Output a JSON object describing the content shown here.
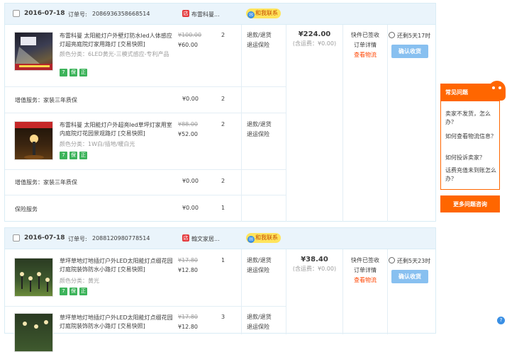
{
  "orders": [
    {
      "date": "2016-07-18",
      "order_label": "订单号:",
      "order_no": "2086936358668514",
      "shop": "布雷科曼...",
      "chat": "和我联系",
      "total": "¥224.00",
      "shipping": "(含运费：¥0.00)",
      "status": "快件已签收",
      "detail": "订单详情",
      "logistics": "查看物流",
      "timer": "还剩5天17时",
      "confirm": "确认收货",
      "items": [
        {
          "title": "布雷科曼 太阳能灯户外壁灯防水led人体感应灯超亮庭院灯家用路灯 [交易快照]",
          "sku": "颜色分类：6LED黄光-三模式感应-专利产品",
          "old_price": "¥100.00",
          "price": "¥60.00",
          "qty": "2",
          "svc1": "退款/退货",
          "svc2": "退运保险"
        },
        {
          "title": "布雷科曼 太阳能灯户外超亮led草坪灯家用室内庭院灯花园景观路灯 [交易快照]",
          "sku": "颜色分类：1W白/插地/暖白光",
          "old_price": "¥88.00",
          "price": "¥52.00",
          "qty": "2",
          "svc1": "退款/退货",
          "svc2": "退运保险"
        }
      ],
      "service_rows": [
        {
          "label": "增值服务：家装三年质保",
          "price": "¥0.00",
          "qty": "2"
        },
        {
          "label": "增值服务：家装三年质保",
          "price": "¥0.00",
          "qty": "2"
        },
        {
          "label": "保险服务",
          "price": "¥0.00",
          "qty": "1"
        }
      ]
    },
    {
      "date": "2016-07-18",
      "order_label": "订单号:",
      "order_no": "2088120980778514",
      "shop": "翰文家居...",
      "chat": "和我联系",
      "total": "¥38.40",
      "shipping": "(含运费：¥0.00)",
      "status": "快件已签收",
      "detail": "订单详情",
      "logistics": "查看物流",
      "timer": "还剩5天23时",
      "confirm": "确认收货",
      "items": [
        {
          "title": "草坪草地灯地插灯户外LED太阳能灯点缀花园灯庭院装饰防水小路灯 [交易快照]",
          "sku": "颜色分类：黄光",
          "old_price": "¥17.80",
          "price": "¥12.80",
          "qty": "1",
          "svc1": "退款/退货",
          "svc2": "退运保险"
        },
        {
          "title": "草坪草地灯地插灯户外LED太阳能灯点缀花园灯庭院装饰防水小路灯 [交易快照]",
          "sku": "",
          "old_price": "¥17.80",
          "price": "¥12.80",
          "qty": "3",
          "svc1": "退款/退货",
          "svc2": "退运保险"
        }
      ]
    }
  ],
  "faq": {
    "title": "常见问题",
    "q1": "卖家不发货，怎么办？",
    "q2": "如何查看物流信息？",
    "q3": "如何投诉卖家？",
    "q4": "话费充值未到账怎么办？",
    "more": "更多问题咨询"
  },
  "colors": {
    "accent": "#ff6600",
    "header_bg": "#eaf4fb",
    "price_red": "#ff4400"
  }
}
